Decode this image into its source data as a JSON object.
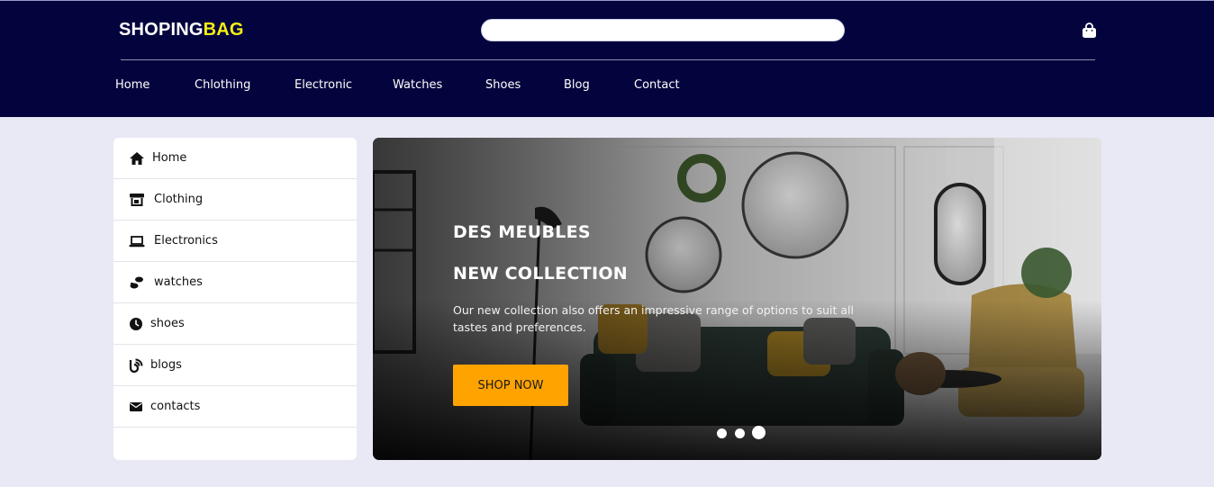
{
  "header": {
    "logo_main": "SHOPING",
    "logo_accent": "BAG",
    "search_placeholder": "",
    "cart_icon": "shopping-bag-icon",
    "nav": [
      "Home",
      "Chlothing",
      "Electronic",
      "Watches",
      "Shoes",
      "Blog",
      "Contact"
    ]
  },
  "sidebar": {
    "items": [
      {
        "label": "Home",
        "icon": "home-icon"
      },
      {
        "label": "Clothing",
        "icon": "store-icon"
      },
      {
        "label": "Electronics",
        "icon": "laptop-icon"
      },
      {
        "label": "watches",
        "icon": "footprints-icon"
      },
      {
        "label": "shoes",
        "icon": "clock-icon"
      },
      {
        "label": "blogs",
        "icon": "blog-icon"
      },
      {
        "label": "contacts",
        "icon": "envelope-icon"
      }
    ]
  },
  "hero": {
    "heading1": "DES MEUBLES",
    "heading2": "NEW COLLECTION",
    "text": "Our new collection also offers an impressive range of options to suit all tastes and preferences.",
    "button": "SHOP NOW",
    "slides": 3,
    "active_slide": 3
  },
  "colors": {
    "header_bg": "#03033d",
    "page_bg": "#e8e9f5",
    "logo_accent": "#f4ef15",
    "button_bg": "#ffa300"
  }
}
